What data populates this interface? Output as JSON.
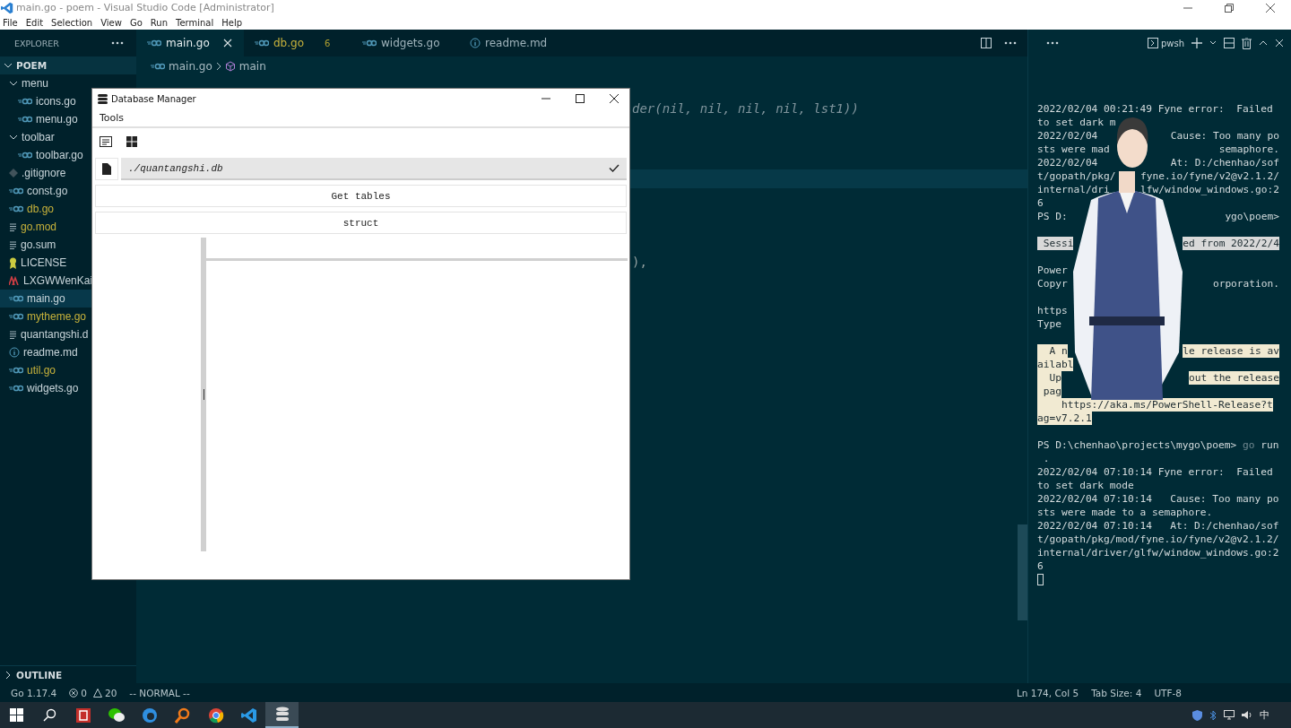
{
  "window": {
    "title": "main.go - poem - Visual Studio Code [Administrator]"
  },
  "menu": [
    "File",
    "Edit",
    "Selection",
    "View",
    "Go",
    "Run",
    "Terminal",
    "Help"
  ],
  "explorer": {
    "title": "EXPLORER",
    "root": "POEM",
    "expanded": true,
    "outline": "OUTLINE",
    "items": [
      {
        "label": "menu",
        "kind": "folder",
        "expanded": true,
        "children": [
          {
            "label": "icons.go",
            "kind": "go",
            "modified": false,
            "selected": false
          },
          {
            "label": "menu.go",
            "kind": "go",
            "modified": false,
            "selected": false
          }
        ]
      },
      {
        "label": "toolbar",
        "kind": "folder",
        "expanded": true,
        "children": [
          {
            "label": "toolbar.go",
            "kind": "go",
            "modified": false,
            "selected": false
          }
        ]
      },
      {
        "label": ".gitignore",
        "kind": "git",
        "modified": false,
        "selected": false
      },
      {
        "label": "const.go",
        "kind": "go",
        "modified": false,
        "selected": false
      },
      {
        "label": "db.go",
        "kind": "go",
        "modified": true,
        "selected": false
      },
      {
        "label": "go.mod",
        "kind": "text",
        "modified": true,
        "selected": false
      },
      {
        "label": "go.sum",
        "kind": "text",
        "modified": false,
        "selected": false
      },
      {
        "label": "LICENSE",
        "kind": "license",
        "modified": false,
        "selected": false
      },
      {
        "label": "LXGWWenKai",
        "kind": "font",
        "modified": false,
        "selected": false
      },
      {
        "label": "main.go",
        "kind": "go",
        "modified": false,
        "selected": true
      },
      {
        "label": "mytheme.go",
        "kind": "go",
        "modified": true,
        "selected": false
      },
      {
        "label": "quantangshi.d",
        "kind": "text",
        "modified": false,
        "selected": false
      },
      {
        "label": "readme.md",
        "kind": "info",
        "modified": false,
        "selected": false
      },
      {
        "label": "util.go",
        "kind": "go",
        "modified": true,
        "selected": false
      },
      {
        "label": "widgets.go",
        "kind": "go",
        "modified": false,
        "selected": false
      }
    ]
  },
  "tabs": [
    {
      "label": "main.go",
      "kind": "go",
      "selected": true,
      "modified": false
    },
    {
      "label": "db.go",
      "kind": "go",
      "selected": false,
      "modified": true,
      "badge": "6"
    },
    {
      "label": "widgets.go",
      "kind": "go",
      "selected": false,
      "modified": false
    },
    {
      "label": "readme.md",
      "kind": "info",
      "selected": false,
      "modified": false
    }
  ],
  "breadcrumbs": [
    "main.go",
    "main"
  ],
  "editor": {
    "code": [
      "der(nil, nil, nil, nil, lst1))",
      "),"
    ]
  },
  "panel": {
    "shell": "pwsh",
    "lines": [
      {
        "kind": "text",
        "parts": [
          "2022/02/04 00:21:49 Fyne error:  Failed"
        ]
      },
      {
        "kind": "text",
        "parts": [
          "to set dark m"
        ]
      },
      {
        "kind": "text",
        "parts": [
          "2022/02/04",
          "Cause: Too many po"
        ]
      },
      {
        "kind": "text",
        "parts": [
          "sts were mad",
          "semaphore."
        ]
      },
      {
        "kind": "text",
        "parts": [
          "2022/02/04",
          "At: D:/chenhao/sof"
        ]
      },
      {
        "kind": "text",
        "parts": [
          "t/gopath/pkg/",
          "fyne.io/fyne/v2@v2.1.2/"
        ]
      },
      {
        "kind": "text",
        "parts": [
          "internal/dri",
          "lfw/window_windows.go:2"
        ]
      },
      {
        "kind": "text",
        "parts": [
          "6"
        ]
      },
      {
        "kind": "text",
        "parts": [
          "PS D:",
          "ygo\\poem>"
        ]
      },
      {
        "kind": "blank"
      },
      {
        "kind": "banner",
        "parts": [
          " Sessi",
          "ed from 2022/2/4"
        ]
      },
      {
        "kind": "blank"
      },
      {
        "kind": "text",
        "parts": [
          "Power"
        ]
      },
      {
        "kind": "text",
        "parts": [
          "Copyr",
          "orporation."
        ]
      },
      {
        "kind": "blank"
      },
      {
        "kind": "text",
        "parts": [
          "https"
        ]
      },
      {
        "kind": "text",
        "parts": [
          "Type"
        ]
      },
      {
        "kind": "blank"
      },
      {
        "kind": "notice",
        "parts": [
          "  A n",
          "le release is av"
        ]
      },
      {
        "kind": "notice",
        "parts": [
          "ailabl"
        ]
      },
      {
        "kind": "notice",
        "parts": [
          "  Up",
          "out the release"
        ]
      },
      {
        "kind": "notice",
        "parts": [
          " pag"
        ]
      },
      {
        "kind": "notice",
        "parts": [
          "    https://aka.ms/PowerShell-Release?t"
        ]
      },
      {
        "kind": "notice",
        "parts": [
          "ag=v7.2.1"
        ]
      },
      {
        "kind": "blank"
      },
      {
        "kind": "command",
        "prompt": "PS D:\\chenhao\\projects\\mygo\\poem>",
        "command": "go",
        "args": "run"
      },
      {
        "kind": "text",
        "parts": [
          " ."
        ]
      },
      {
        "kind": "text",
        "parts": [
          "2022/02/04 07:10:14 Fyne error:  Failed"
        ]
      },
      {
        "kind": "text",
        "parts": [
          "to set dark mode"
        ]
      },
      {
        "kind": "text",
        "parts": [
          "2022/02/04 07:10:14   Cause: Too many po"
        ]
      },
      {
        "kind": "text",
        "parts": [
          "sts were made to a semaphore."
        ]
      },
      {
        "kind": "text",
        "parts": [
          "2022/02/04 07:10:14   At: D:/chenhao/sof"
        ]
      },
      {
        "kind": "text",
        "parts": [
          "t/gopath/pkg/mod/fyne.io/fyne/v2@v2.1.2/"
        ]
      },
      {
        "kind": "text",
        "parts": [
          "internal/driver/glfw/window_windows.go:2"
        ]
      },
      {
        "kind": "text",
        "parts": [
          "6"
        ]
      },
      {
        "kind": "cursor"
      }
    ]
  },
  "dialog": {
    "title": "Database Manager",
    "menu": [
      "Tools"
    ],
    "path": {
      "value": "./quantangshi.db",
      "valid": true
    },
    "buttons": [
      "Get tables",
      "struct"
    ]
  },
  "status_bar": {
    "go": "Go 1.17.4",
    "errors": "0",
    "warnings": "20",
    "mode": "-- NORMAL --",
    "right": [
      "Ln 174, Col 5",
      "Tab Size: 4",
      "UTF-8"
    ]
  },
  "taskbar": {
    "apps": [
      {
        "kind": "document",
        "active": false
      },
      {
        "kind": "chat",
        "active": false
      },
      {
        "kind": "browser",
        "active": false
      },
      {
        "kind": "finder",
        "active": false
      },
      {
        "kind": "chrome",
        "active": false
      },
      {
        "kind": "code",
        "active": false
      },
      {
        "kind": "database",
        "active": true
      }
    ],
    "ime": "中"
  }
}
